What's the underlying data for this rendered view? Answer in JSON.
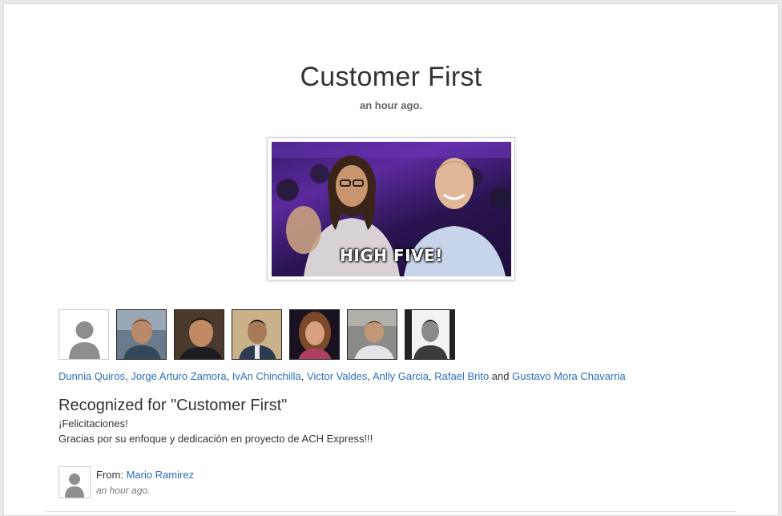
{
  "post": {
    "title": "Customer First",
    "time": "an hour ago.",
    "gif_caption": "HIGH FIVE!"
  },
  "recipients": [
    {
      "name": "Dunnia Quiros",
      "avatar": "placeholder-avatar-icon"
    },
    {
      "name": "Jorge Arturo Zamora",
      "avatar": "photo"
    },
    {
      "name": "IvAn Chinchilla",
      "avatar": "photo"
    },
    {
      "name": "Victor Valdes",
      "avatar": "photo"
    },
    {
      "name": "Anlly Garcia",
      "avatar": "photo"
    },
    {
      "name": "Rafael Brito",
      "avatar": "photo"
    },
    {
      "name": "Gustavo Mora Chavarria",
      "avatar": "photo"
    }
  ],
  "separators": {
    "comma": ", ",
    "and": " and "
  },
  "recognition": {
    "heading": "Recognized for \"Customer First\"",
    "line1": "¡Felicitaciones!",
    "line2": "Gracias por su enfoque y dedicación en proyecto de ACH Express!!!"
  },
  "sender": {
    "label": "From: ",
    "name": "Mario Ramirez",
    "time": "an hour ago."
  },
  "colors": {
    "link": "#2a6ebb",
    "text": "#333333"
  }
}
